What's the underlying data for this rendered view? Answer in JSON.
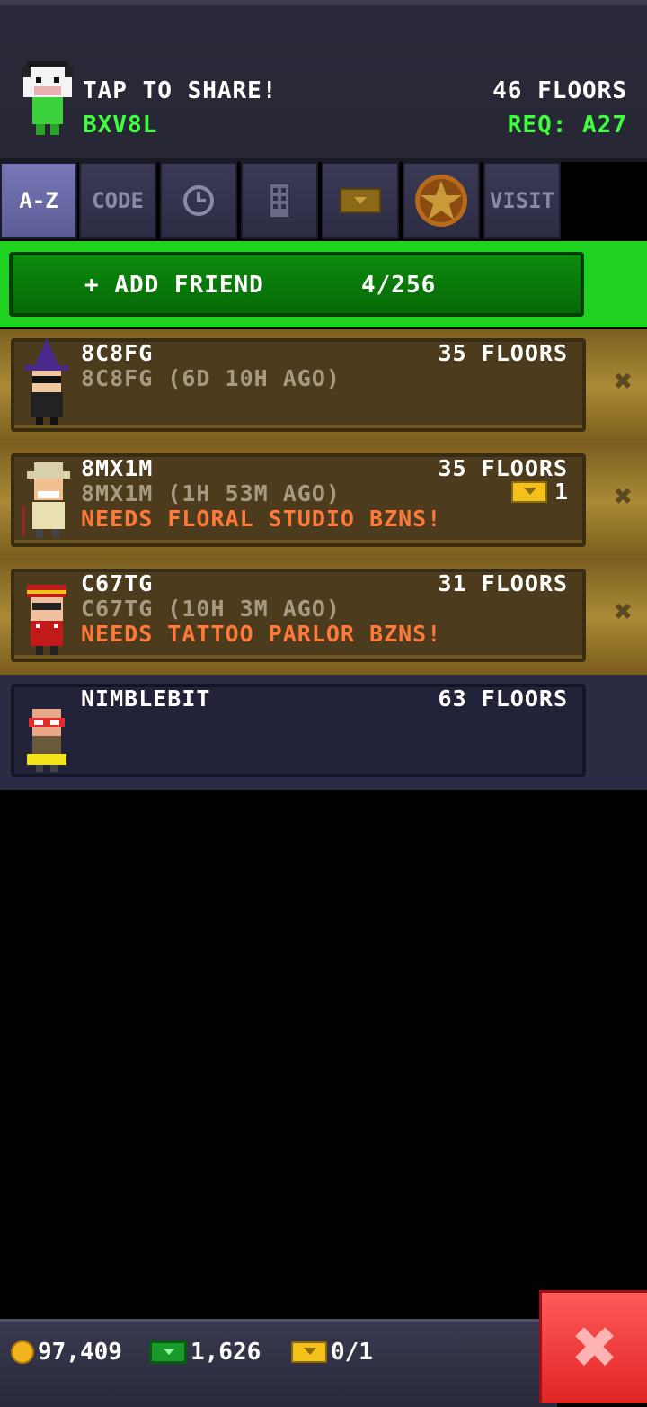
{
  "header": {
    "share_text": "TAP TO SHARE!",
    "user_code": "BXV8L",
    "floors": "46 FLOORS",
    "requirement": "REQ: A27"
  },
  "tabs": [
    {
      "label": "A-Z",
      "active": true
    },
    {
      "label": "CODE",
      "active": false
    },
    {
      "icon": "clock-icon"
    },
    {
      "icon": "building-icon"
    },
    {
      "icon": "ticket-icon"
    },
    {
      "icon": "star-medal-icon"
    },
    {
      "label": "VISIT",
      "active": false
    }
  ],
  "add_friend": {
    "label": "+ ADD FRIEND",
    "count": "4/256"
  },
  "friends": [
    {
      "name": "8C8FG",
      "floors": "35 FLOORS",
      "sub": "8C8FG (6D 10H AGO)",
      "needs": "",
      "style": "gold"
    },
    {
      "name": "8MX1M",
      "floors": "35 FLOORS",
      "sub": "8MX1M (1H 53M AGO)",
      "needs": "NEEDS FLORAL STUDIO BZNS!",
      "tickets": "1",
      "style": "gold"
    },
    {
      "name": "C67TG",
      "floors": "31 FLOORS",
      "sub": "C67TG (10H 3M AGO)",
      "needs": "NEEDS TATTOO PARLOR BZNS!",
      "style": "gold"
    },
    {
      "name": "NIMBLEBIT",
      "floors": "63 FLOORS",
      "sub": "",
      "needs": "",
      "style": "blue"
    }
  ],
  "bottom": {
    "coins": "97,409",
    "bux": "1,626",
    "tickets": "0/1"
  },
  "colors": {
    "accent_green": "#3dff3d",
    "needs_orange": "#ff7a3a",
    "close_red": "#e02424"
  }
}
